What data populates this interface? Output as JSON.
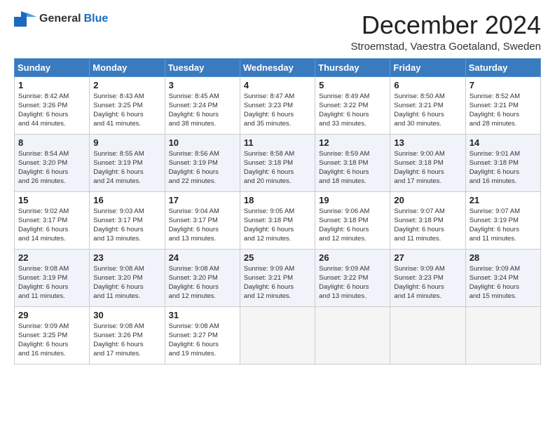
{
  "header": {
    "logo_general": "General",
    "logo_blue": "Blue",
    "month_title": "December 2024",
    "subtitle": "Stroemstad, Vaestra Goetaland, Sweden"
  },
  "weekdays": [
    "Sunday",
    "Monday",
    "Tuesday",
    "Wednesday",
    "Thursday",
    "Friday",
    "Saturday"
  ],
  "weeks": [
    [
      {
        "day": "1",
        "sunrise": "8:42 AM",
        "sunset": "3:26 PM",
        "daylight": "6 hours and 44 minutes."
      },
      {
        "day": "2",
        "sunrise": "8:43 AM",
        "sunset": "3:25 PM",
        "daylight": "6 hours and 41 minutes."
      },
      {
        "day": "3",
        "sunrise": "8:45 AM",
        "sunset": "3:24 PM",
        "daylight": "6 hours and 38 minutes."
      },
      {
        "day": "4",
        "sunrise": "8:47 AM",
        "sunset": "3:23 PM",
        "daylight": "6 hours and 35 minutes."
      },
      {
        "day": "5",
        "sunrise": "8:49 AM",
        "sunset": "3:22 PM",
        "daylight": "6 hours and 33 minutes."
      },
      {
        "day": "6",
        "sunrise": "8:50 AM",
        "sunset": "3:21 PM",
        "daylight": "6 hours and 30 minutes."
      },
      {
        "day": "7",
        "sunrise": "8:52 AM",
        "sunset": "3:21 PM",
        "daylight": "6 hours and 28 minutes."
      }
    ],
    [
      {
        "day": "8",
        "sunrise": "8:54 AM",
        "sunset": "3:20 PM",
        "daylight": "6 hours and 26 minutes."
      },
      {
        "day": "9",
        "sunrise": "8:55 AM",
        "sunset": "3:19 PM",
        "daylight": "6 hours and 24 minutes."
      },
      {
        "day": "10",
        "sunrise": "8:56 AM",
        "sunset": "3:19 PM",
        "daylight": "6 hours and 22 minutes."
      },
      {
        "day": "11",
        "sunrise": "8:58 AM",
        "sunset": "3:18 PM",
        "daylight": "6 hours and 20 minutes."
      },
      {
        "day": "12",
        "sunrise": "8:59 AM",
        "sunset": "3:18 PM",
        "daylight": "6 hours and 18 minutes."
      },
      {
        "day": "13",
        "sunrise": "9:00 AM",
        "sunset": "3:18 PM",
        "daylight": "6 hours and 17 minutes."
      },
      {
        "day": "14",
        "sunrise": "9:01 AM",
        "sunset": "3:18 PM",
        "daylight": "6 hours and 16 minutes."
      }
    ],
    [
      {
        "day": "15",
        "sunrise": "9:02 AM",
        "sunset": "3:17 PM",
        "daylight": "6 hours and 14 minutes."
      },
      {
        "day": "16",
        "sunrise": "9:03 AM",
        "sunset": "3:17 PM",
        "daylight": "6 hours and 13 minutes."
      },
      {
        "day": "17",
        "sunrise": "9:04 AM",
        "sunset": "3:17 PM",
        "daylight": "6 hours and 13 minutes."
      },
      {
        "day": "18",
        "sunrise": "9:05 AM",
        "sunset": "3:18 PM",
        "daylight": "6 hours and 12 minutes."
      },
      {
        "day": "19",
        "sunrise": "9:06 AM",
        "sunset": "3:18 PM",
        "daylight": "6 hours and 12 minutes."
      },
      {
        "day": "20",
        "sunrise": "9:07 AM",
        "sunset": "3:18 PM",
        "daylight": "6 hours and 11 minutes."
      },
      {
        "day": "21",
        "sunrise": "9:07 AM",
        "sunset": "3:19 PM",
        "daylight": "6 hours and 11 minutes."
      }
    ],
    [
      {
        "day": "22",
        "sunrise": "9:08 AM",
        "sunset": "3:19 PM",
        "daylight": "6 hours and 11 minutes."
      },
      {
        "day": "23",
        "sunrise": "9:08 AM",
        "sunset": "3:20 PM",
        "daylight": "6 hours and 11 minutes."
      },
      {
        "day": "24",
        "sunrise": "9:08 AM",
        "sunset": "3:20 PM",
        "daylight": "6 hours and 12 minutes."
      },
      {
        "day": "25",
        "sunrise": "9:09 AM",
        "sunset": "3:21 PM",
        "daylight": "6 hours and 12 minutes."
      },
      {
        "day": "26",
        "sunrise": "9:09 AM",
        "sunset": "3:22 PM",
        "daylight": "6 hours and 13 minutes."
      },
      {
        "day": "27",
        "sunrise": "9:09 AM",
        "sunset": "3:23 PM",
        "daylight": "6 hours and 14 minutes."
      },
      {
        "day": "28",
        "sunrise": "9:09 AM",
        "sunset": "3:24 PM",
        "daylight": "6 hours and 15 minutes."
      }
    ],
    [
      {
        "day": "29",
        "sunrise": "9:09 AM",
        "sunset": "3:25 PM",
        "daylight": "6 hours and 16 minutes."
      },
      {
        "day": "30",
        "sunrise": "9:08 AM",
        "sunset": "3:26 PM",
        "daylight": "6 hours and 17 minutes."
      },
      {
        "day": "31",
        "sunrise": "9:08 AM",
        "sunset": "3:27 PM",
        "daylight": "6 hours and 19 minutes."
      },
      null,
      null,
      null,
      null
    ]
  ]
}
